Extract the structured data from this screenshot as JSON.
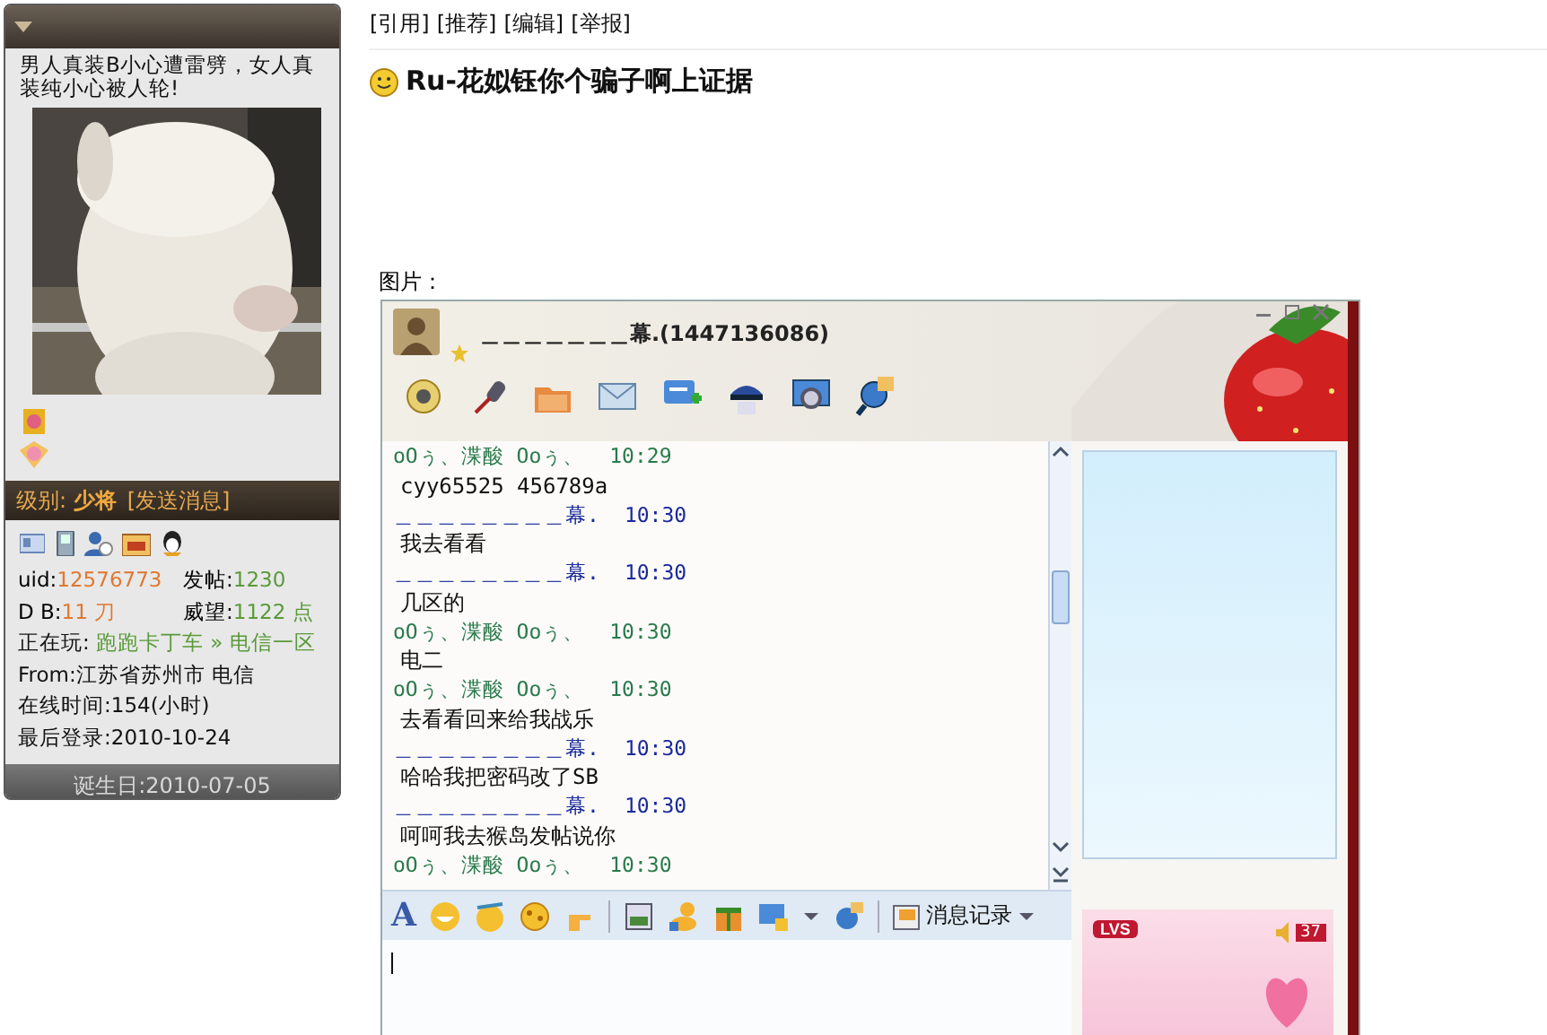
{
  "sidebar": {
    "signature": "男人真装B小心遭雷劈，女人真装纯小心被人轮!",
    "avatar": {
      "kind": "picture"
    },
    "level": {
      "label": "级别:",
      "rank": "少将",
      "message_link": "[发送消息]"
    },
    "stats": [
      {
        "label": "uid:",
        "value": "12576773"
      },
      {
        "label": "发帖:",
        "value": "1230"
      },
      {
        "label": "D B:",
        "value": "11 刀"
      },
      {
        "label": "威望:",
        "value": "1122 点"
      }
    ],
    "playing": {
      "label": "正在玩:",
      "value": "跑跑卡丁车 » 电信一区"
    },
    "info": [
      "From:江苏省苏州市 电信",
      "在线时间:154(小时)",
      "最后登录:2010-10-24"
    ],
    "birthday": "诞生日:2010-07-05"
  },
  "post": {
    "actions": [
      "[引用]",
      "[推荐]",
      "[编辑]",
      "[举报]"
    ],
    "title": "Ru-花姒钰你个骗子啊上证据",
    "image_label": "图片：",
    "chat": {
      "title": "＿＿＿＿＿＿＿幕.(1447136086)",
      "messages": [
        {
          "kind": "friend",
          "sender": "oOぅ、渫酸 Ooぅ、",
          "time": "10:29",
          "text": "cyy65525 456789a"
        },
        {
          "kind": "self",
          "sender": "＿＿＿＿＿＿＿＿幕.",
          "time": "10:30",
          "text": "我去看看"
        },
        {
          "kind": "self",
          "sender": "＿＿＿＿＿＿＿＿幕.",
          "time": "10:30",
          "text": "几区的"
        },
        {
          "kind": "friend",
          "sender": "oOぅ、渫酸 Ooぅ、",
          "time": "10:30",
          "text": "电二"
        },
        {
          "kind": "friend",
          "sender": "oOぅ、渫酸 Ooぅ、",
          "time": "10:30",
          "text": "去看看回来给我战乐"
        },
        {
          "kind": "self",
          "sender": "＿＿＿＿＿＿＿＿幕.",
          "time": "10:30",
          "text": "哈哈我把密码改了SB"
        },
        {
          "kind": "self",
          "sender": "＿＿＿＿＿＿＿＿幕.",
          "time": "10:30",
          "text": "呵呵我去猴岛发帖说你"
        },
        {
          "kind": "friend",
          "sender": "oOぅ、渫酸 Ooぅ、",
          "time": "10:30"
        }
      ],
      "font_button": "A",
      "history_button": "消息记录",
      "ad": {
        "brand": "LVS",
        "volume": "37"
      }
    }
  }
}
